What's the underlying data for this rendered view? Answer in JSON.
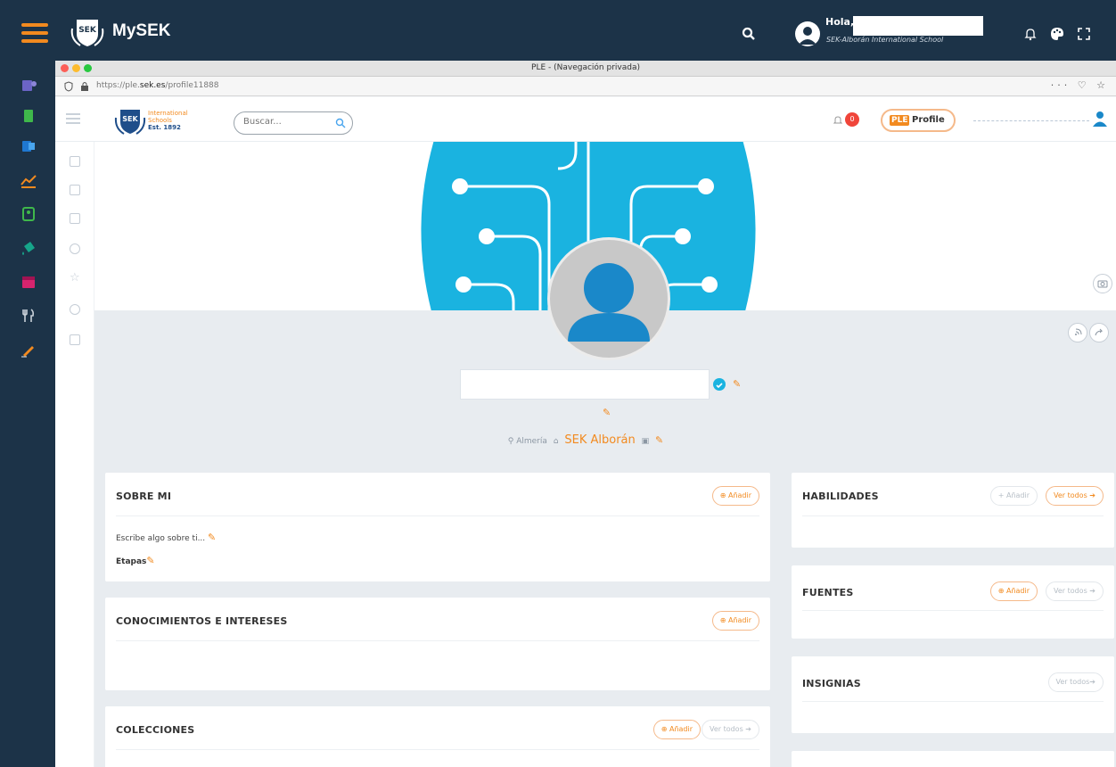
{
  "topbar": {
    "title": "MySEK",
    "greeting": "Hola,",
    "school": "SEK-Alborán International School",
    "icons": [
      "search-icon",
      "user-icon",
      "bell-icon",
      "palette-icon",
      "fullscreen-icon"
    ]
  },
  "browser": {
    "window_title": "PLE - (Navegación privada)",
    "url_prefix": "https://ple.",
    "url_domain": "sek.es",
    "url_path": "/profile11888",
    "url_actions": "··· ♡ ☆"
  },
  "app": {
    "brand_line1": "International",
    "brand_line2": "Schools",
    "brand_line3": "Est. 1892",
    "search_placeholder": "Buscar...",
    "notif_count": "0",
    "ple_tag": "PLE",
    "ple_label": "Profile"
  },
  "profile": {
    "location": "Almería",
    "school": "SEK Alborán",
    "colors": {
      "accent": "#f28a1f",
      "cover": "#1ab3e0",
      "avatar": "#1a88c9"
    }
  },
  "cards": {
    "sobre": {
      "title": "SOBRE MI",
      "add": "⊕ Añadir",
      "placeholder": "Escribe algo sobre ti...",
      "etapas": "Etapas"
    },
    "conocimientos": {
      "title": "CONOCIMIENTOS E INTERESES",
      "add": "⊕ Añadir"
    },
    "colecciones": {
      "title": "COLECCIONES",
      "add": "⊕ Añadir",
      "ver": "Ver todos ➔"
    },
    "habilidades": {
      "title": "HABILIDADES",
      "add": "+ Añadir",
      "ver": "Ver todos ➔"
    },
    "fuentes": {
      "title": "FUENTES",
      "add": "⊕ Añadir",
      "ver": "Ver todos ➔"
    },
    "insignias": {
      "title": "INSIGNIAS",
      "ver": "Ver todos➔"
    }
  }
}
